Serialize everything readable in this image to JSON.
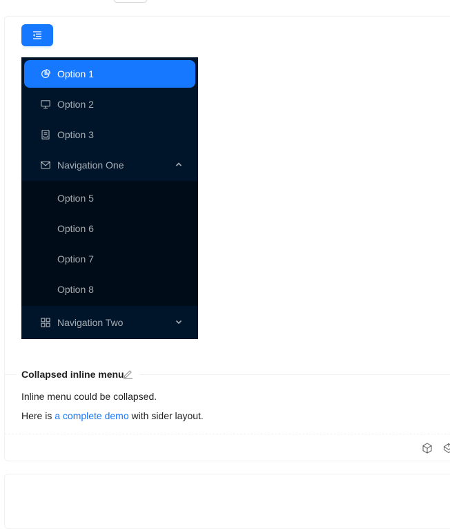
{
  "menu": {
    "items": [
      {
        "label": "Option 1",
        "icon": "pie-chart-icon",
        "selected": true
      },
      {
        "label": "Option 2",
        "icon": "desktop-icon"
      },
      {
        "label": "Option 3",
        "icon": "container-icon"
      },
      {
        "label": "Navigation One",
        "icon": "mail-icon",
        "expanded": true,
        "children": [
          "Option 5",
          "Option 6",
          "Option 7",
          "Option 8"
        ]
      },
      {
        "label": "Navigation Two",
        "icon": "appstore-icon",
        "expanded": false
      }
    ]
  },
  "demo": {
    "title": "Collapsed inline menu",
    "description": "Inline menu could be collapsed.",
    "footer_prefix": "Here is ",
    "footer_link": "a complete demo",
    "footer_suffix": " with sider layout."
  },
  "colors": {
    "primary": "#1677ff",
    "menu_dark": "#001529",
    "submenu_dark": "#000c17"
  }
}
